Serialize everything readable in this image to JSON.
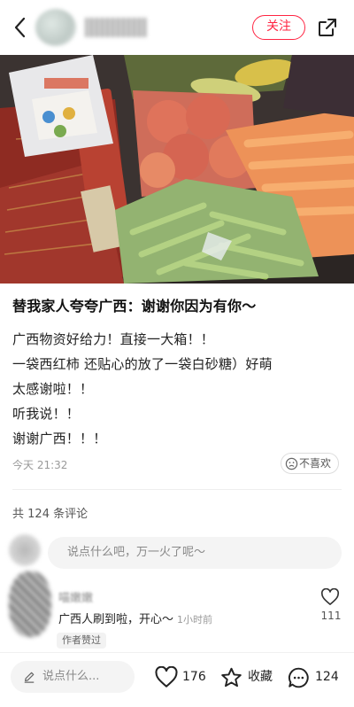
{
  "header": {
    "follow_label": "关注"
  },
  "post": {
    "title": "替我家人夸夸广西：谢谢你因为有你～",
    "body_lines": [
      "广西物资好给力！直接一大箱！！",
      "一袋西红柿 还贴心的放了一袋白砂糖）好萌",
      "太感谢啦！！",
      "听我说！！",
      "谢谢广西！！！"
    ],
    "time": "今天 21:32",
    "dislike_label": "不喜欢"
  },
  "comments": {
    "count_prefix": "共",
    "count": "124",
    "count_suffix": "条评论",
    "input_placeholder": "说点什么吧，万一火了呢～",
    "items": [
      {
        "author": "喵嫩嫩",
        "text": "广西人刷到啦，开心～",
        "time": "1小时前",
        "badge": "作者赞过",
        "likes": "111"
      }
    ]
  },
  "bottom_bar": {
    "input_placeholder": "说点什么...",
    "likes": "176",
    "collect_label": "收藏",
    "comments": "124"
  },
  "colors": {
    "accent": "#ff2442"
  }
}
